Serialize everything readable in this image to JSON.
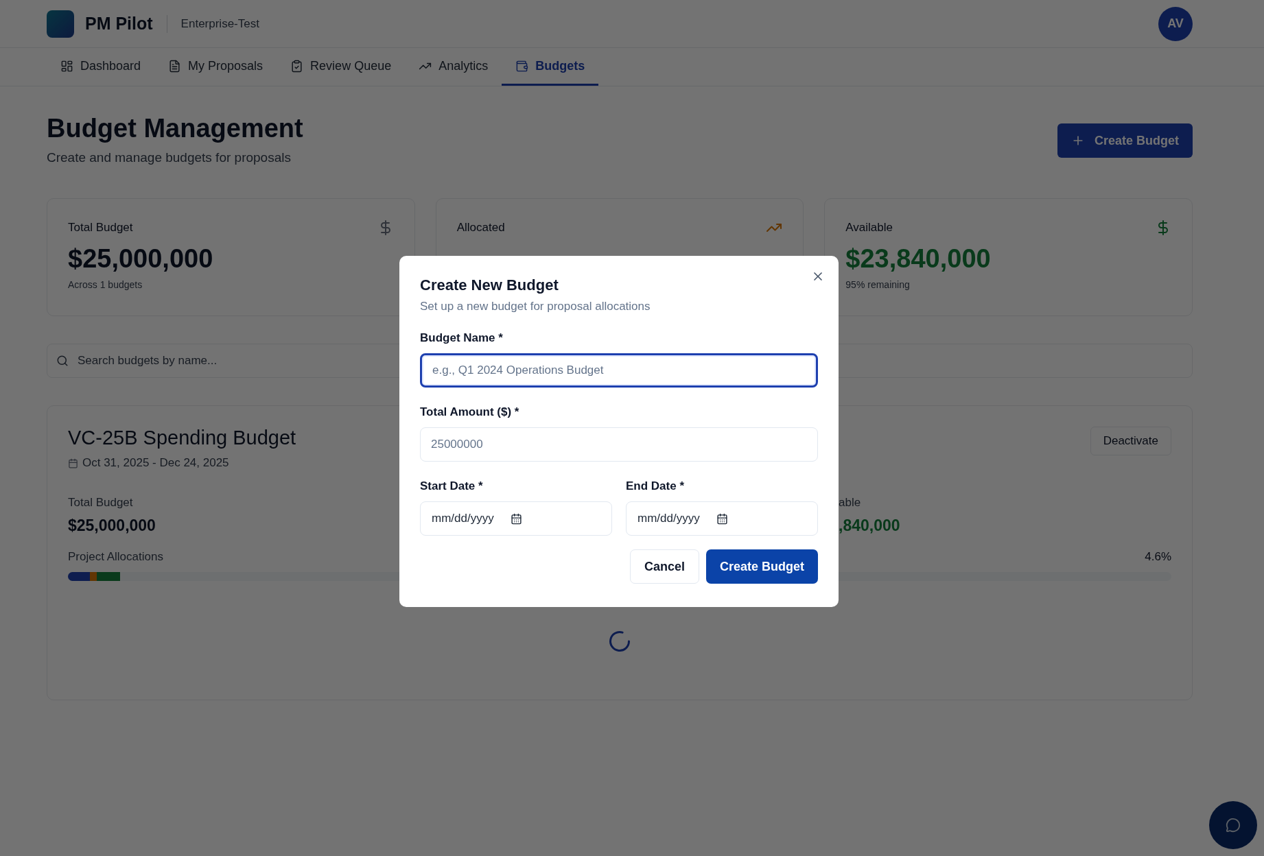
{
  "header": {
    "logo_text": "PM Pilot",
    "workspace": "Enterprise-Test",
    "avatar": "AV"
  },
  "tabs": [
    {
      "label": "Dashboard",
      "selected": false
    },
    {
      "label": "My Proposals",
      "selected": false
    },
    {
      "label": "Review Queue",
      "selected": false
    },
    {
      "label": "Analytics",
      "selected": false
    },
    {
      "label": "Budgets",
      "selected": true
    }
  ],
  "page": {
    "title": "Budget Management",
    "subtitle": "Create and manage budgets for proposals",
    "create_button": "Create Budget"
  },
  "stats": [
    {
      "kind": "total",
      "label": "Total Budget",
      "value": "$25,000,000",
      "note": "Across 1 budgets"
    },
    {
      "kind": "allocated",
      "label": "Allocated"
    },
    {
      "kind": "available",
      "label": "Available",
      "value": "$23,840,000",
      "note": "95% remaining"
    }
  ],
  "search": {
    "placeholder": "Search budgets by name..."
  },
  "budget_card": {
    "name": "VC-25B Spending Budget",
    "dates": "Oct 31, 2025 - Dec 24, 2025",
    "deactivate_button": "Deactivate",
    "metrics": [
      {
        "kind": "total",
        "label": "Total Budget",
        "value": "$25,000,000"
      },
      {
        "kind": "available",
        "label": "able",
        "value": ",840,000"
      }
    ],
    "allocations_label": "Project Allocations",
    "allocations_percent": "4.6%",
    "segments": [
      {
        "color": "#0e1d4f",
        "level": 0.02
      },
      {
        "color": "#623603",
        "level": 0.006
      },
      {
        "color": "#093a1b",
        "level": 0.021
      }
    ],
    "loading": true
  },
  "dialog": {
    "title": "Create New Budget",
    "description": "Set up a new budget for proposal allocations",
    "fields": [
      {
        "label": "Budget Name *",
        "placeholder": "e.g., Q1 2024 Operations Budget",
        "focused": true
      },
      {
        "label": "Total Amount ($) *",
        "placeholder": "25000000",
        "focused": false
      }
    ],
    "date_fields": [
      {
        "label": "Start Date *",
        "value": "mm/dd/yyyy",
        "focused": false
      },
      {
        "label": "End Date *",
        "value": "mm/dd/yyyy",
        "focused": false
      }
    ],
    "cancel_button": "Cancel",
    "submit_button": "Create Budget"
  }
}
